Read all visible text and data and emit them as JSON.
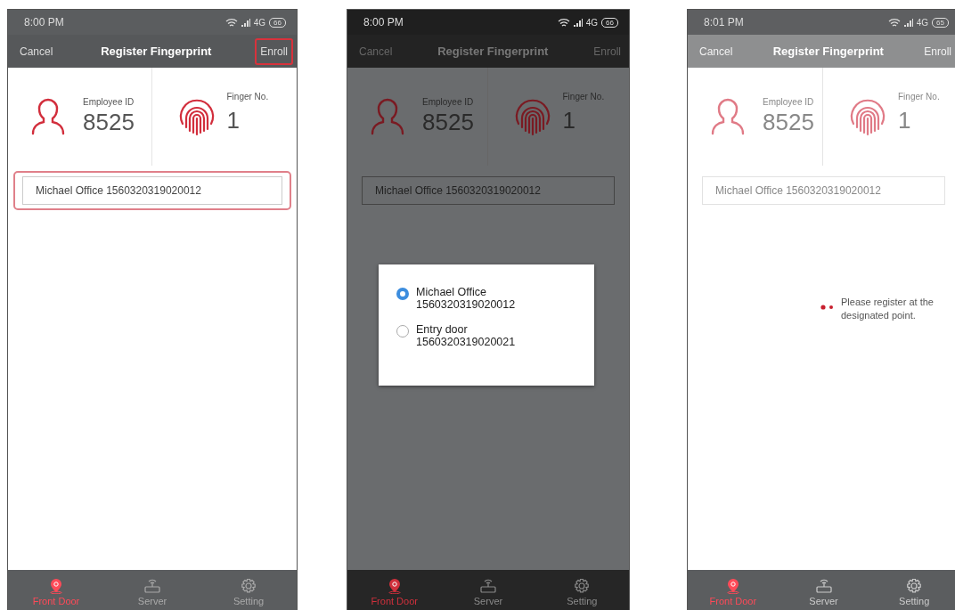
{
  "screens": [
    {
      "kind": "normal",
      "status_bar": {
        "time": "8:00 PM",
        "network": "4G",
        "battery": "66"
      },
      "nav": {
        "cancel": "Cancel",
        "title": "Register Fingerprint",
        "enroll": "Enroll",
        "enroll_highlighted": true
      },
      "employee": {
        "label": "Employee ID",
        "value": "8525"
      },
      "finger": {
        "label": "Finger No.",
        "value": "1"
      },
      "device_field": {
        "value": "Michael Office 1560320319020012",
        "highlighted": true
      },
      "tabs": [
        {
          "label": "Front Door",
          "selected": true
        },
        {
          "label": "Server",
          "selected": false
        },
        {
          "label": "Setting",
          "selected": false
        }
      ]
    },
    {
      "kind": "dimmed",
      "status_bar": {
        "time": "8:00 PM",
        "network": "4G",
        "battery": "66"
      },
      "nav": {
        "cancel": "Cancel",
        "title": "Register Fingerprint",
        "enroll": "Enroll",
        "enroll_highlighted": false
      },
      "employee": {
        "label": "Employee ID",
        "value": "8525"
      },
      "finger": {
        "label": "Finger No.",
        "value": "1"
      },
      "device_field": {
        "value": "Michael Office 1560320319020012",
        "highlighted": false
      },
      "dialog": {
        "options": [
          {
            "name": "Michael Office",
            "serial": "1560320319020012",
            "selected": true
          },
          {
            "name": "Entry door",
            "serial": "1560320319020021",
            "selected": false
          }
        ]
      },
      "tabs": [
        {
          "label": "Front Door",
          "selected": true
        },
        {
          "label": "Server",
          "selected": false
        },
        {
          "label": "Setting",
          "selected": false
        }
      ]
    },
    {
      "kind": "busy",
      "status_bar": {
        "time": "8:01 PM",
        "network": "4G",
        "battery": "65"
      },
      "nav": {
        "cancel": "Cancel",
        "title": "Register Fingerprint",
        "enroll": "Enroll",
        "enroll_highlighted": false
      },
      "employee": {
        "label": "Employee ID",
        "value": "8525"
      },
      "finger": {
        "label": "Finger No.",
        "value": "1"
      },
      "device_field": {
        "value": "Michael Office 1560320319020012",
        "highlighted": false
      },
      "prompt": "Please register at the designated point.",
      "tabs": [
        {
          "label": "Front Door",
          "selected": true
        },
        {
          "label": "Server",
          "selected": false
        },
        {
          "label": "Setting",
          "selected": false
        }
      ]
    }
  ]
}
